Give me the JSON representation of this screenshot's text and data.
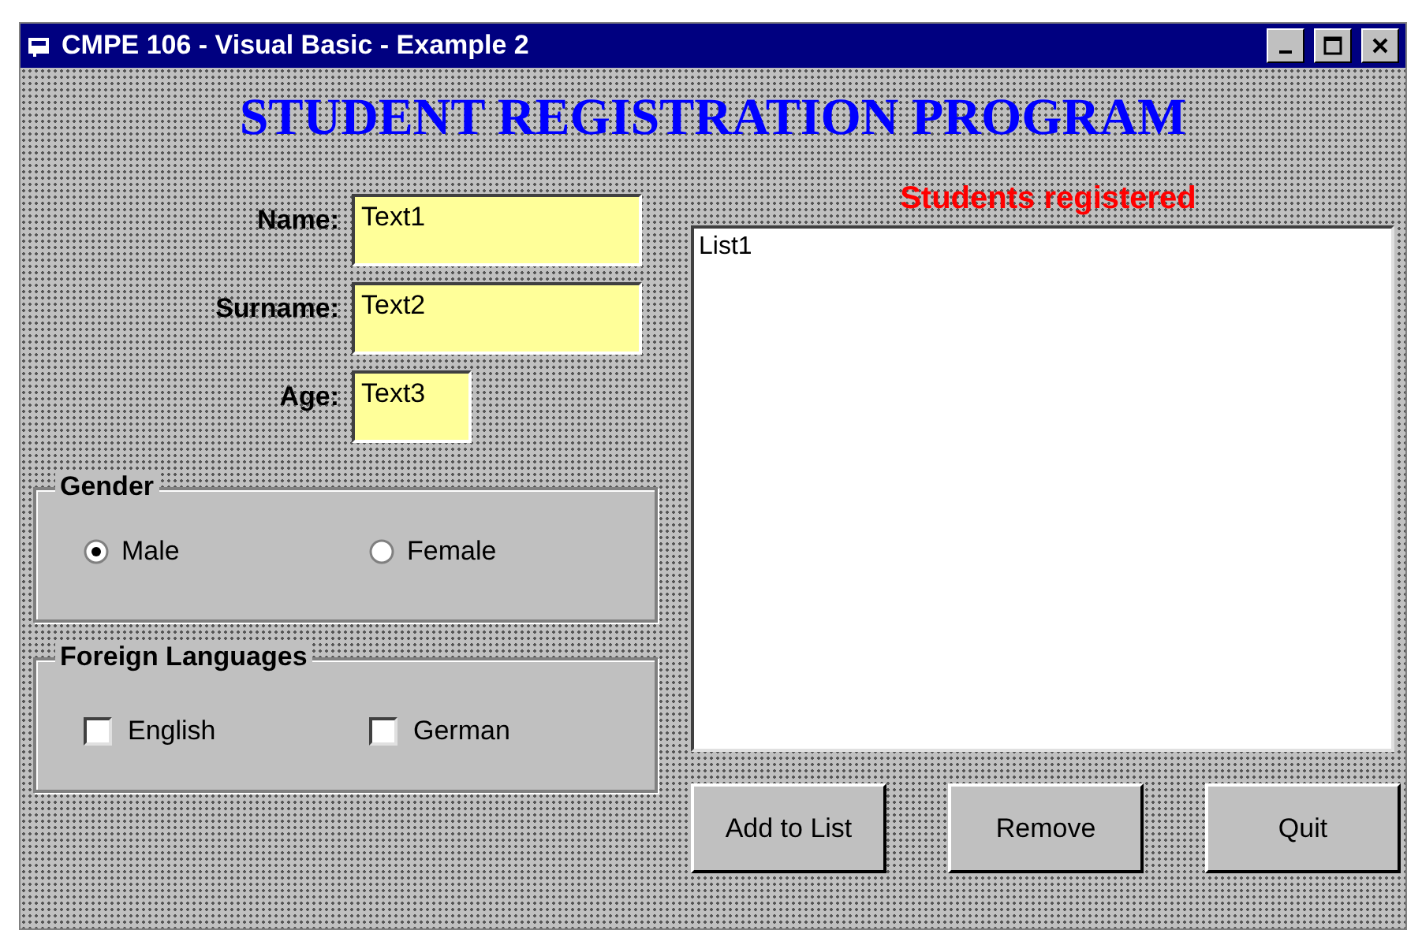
{
  "window": {
    "title": "CMPE 106 - Visual Basic - Example 2"
  },
  "heading": "STUDENT REGISTRATION PROGRAM",
  "fields": [
    {
      "label": "Name:",
      "value": "Text1",
      "kind": "wide"
    },
    {
      "label": "Surname:",
      "value": "Text2",
      "kind": "wide"
    },
    {
      "label": "Age:",
      "value": "Text3",
      "kind": "short"
    }
  ],
  "gender": {
    "title": "Gender",
    "options": [
      {
        "label": "Male",
        "selected": true
      },
      {
        "label": "Female",
        "selected": false
      }
    ]
  },
  "languages": {
    "title": "Foreign Languages",
    "options": [
      {
        "label": "English",
        "checked": false
      },
      {
        "label": "German",
        "checked": false
      }
    ]
  },
  "list": {
    "title": "Students registered",
    "items": [
      "List1"
    ]
  },
  "buttons": [
    "Add to List",
    "Remove",
    "Quit"
  ]
}
